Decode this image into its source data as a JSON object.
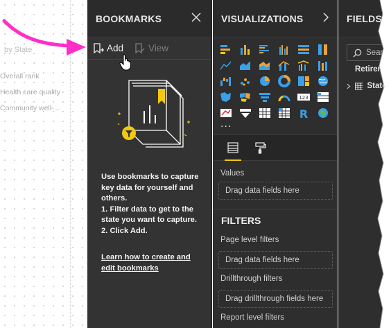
{
  "canvas": {
    "title": "by State",
    "items": [
      "Overall rank",
      "Health care quality",
      "Community well-..."
    ]
  },
  "bookmarks": {
    "title": "BOOKMARKS",
    "close_icon": "close-icon",
    "add_label": "Add",
    "view_label": "View",
    "instructions": [
      "Use bookmarks to capture",
      "key data for yourself and",
      "others.",
      "1. Filter data to get to the",
      "state you want to capture.",
      "2. Click Add."
    ],
    "link_lines": [
      "Learn how to create and",
      "edit bookmarks"
    ]
  },
  "visualizations": {
    "title": "VISUALIZATIONS",
    "collapse_icon": "chevron-right-icon",
    "icons": [
      "stacked-bar-chart-icon",
      "stacked-column-chart-icon",
      "clustered-bar-chart-icon",
      "clustered-column-chart-icon",
      "100-stacked-bar-chart-icon",
      "100-stacked-column-chart-icon",
      "line-chart-icon",
      "area-chart-icon",
      "stacked-area-chart-icon",
      "line-and-column-chart-icon",
      "line-and-clustered-column-chart-icon",
      "ribbon-chart-icon",
      "waterfall-chart-icon",
      "scatter-chart-icon",
      "pie-chart-icon",
      "donut-chart-icon",
      "treemap-icon",
      "map-icon",
      "filled-map-icon",
      "shape-map-icon",
      "funnel-icon",
      "gauge-icon",
      "card-icon",
      "multi-row-card-icon",
      "kpi-icon",
      "slicer-icon",
      "table-icon",
      "matrix-icon",
      "r-visual-icon",
      "globe-icon"
    ],
    "more_label": "...",
    "values_label": "Values",
    "values_placeholder": "Drag data fields here",
    "filters_title": "FILTERS",
    "page_filters_label": "Page level filters",
    "page_filters_placeholder": "Drag data fields here",
    "drill_label": "Drillthrough filters",
    "drill_placeholder": "Drag drillthrough fields here",
    "report_filters_label": "Report level filters"
  },
  "fields": {
    "title": "FIELDS",
    "search_placeholder": "Search",
    "tables": [
      "Retirement",
      "States"
    ]
  },
  "colors": {
    "accent": "#f2c811",
    "arrow": "#ff2ec8",
    "pane_dark": "#2b2b2b"
  }
}
